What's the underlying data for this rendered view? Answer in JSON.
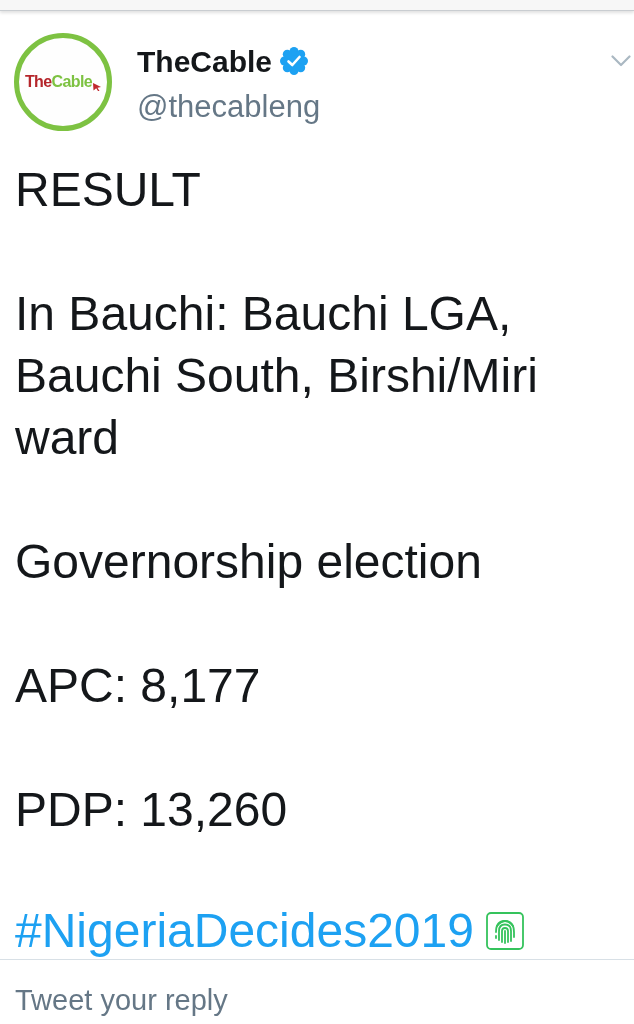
{
  "header": {
    "avatar": {
      "logo_parts": [
        "The",
        "Cable"
      ]
    },
    "name": "TheCable",
    "verified": true,
    "handle": "@thecableng"
  },
  "tweet": {
    "paragraphs": [
      {
        "kind": "text",
        "lines": [
          "RESULT"
        ]
      },
      {
        "kind": "text",
        "lines": [
          "In Bauchi: Bauchi LGA,",
          "Bauchi South, Birshi/Miri",
          "ward"
        ]
      },
      {
        "kind": "text",
        "lines": [
          "Governorship election"
        ]
      },
      {
        "kind": "text",
        "lines": [
          "APC: 8,177"
        ]
      },
      {
        "kind": "text",
        "lines": [
          "PDP: 13,260"
        ]
      },
      {
        "kind": "hashtag",
        "lines": [
          "#NigeriaDecides2019"
        ],
        "hashflag": true
      }
    ]
  },
  "reply": {
    "placeholder": "Tweet your reply"
  }
}
